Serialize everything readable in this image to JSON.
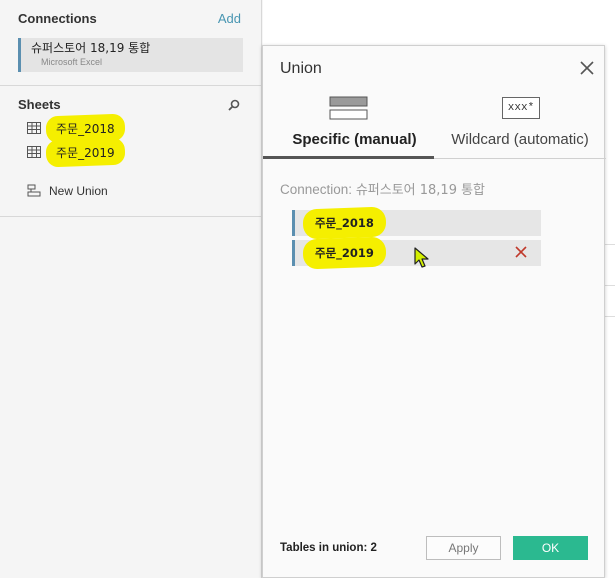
{
  "connections": {
    "title": "Connections",
    "add_label": "Add",
    "items": [
      {
        "name": "슈퍼스토어 18,19 통합",
        "type": "Microsoft Excel"
      }
    ]
  },
  "sheets": {
    "title": "Sheets",
    "items": [
      {
        "label": "주문_2018"
      },
      {
        "label": "주문_2019"
      }
    ],
    "new_union_label": "New Union"
  },
  "dialog": {
    "title": "Union",
    "tabs": [
      {
        "label": "Specific (manual)",
        "selected": true
      },
      {
        "label": "Wildcard (automatic)",
        "selected": false,
        "icon_text": "xxx*"
      }
    ],
    "connection_prefix": "Connection: ",
    "connection_name": "슈퍼스토어 18,19 통합",
    "union_tables": [
      {
        "label": "주문_2018"
      },
      {
        "label": "주문_2019"
      }
    ],
    "tables_in_union": "Tables in union: 2",
    "apply_label": "Apply",
    "ok_label": "OK"
  },
  "colors": {
    "accent_blue": "#4996b2",
    "ok_green": "#2bb990",
    "highlight_yellow": "#f5ef00",
    "remove_red": "#c0392b"
  }
}
